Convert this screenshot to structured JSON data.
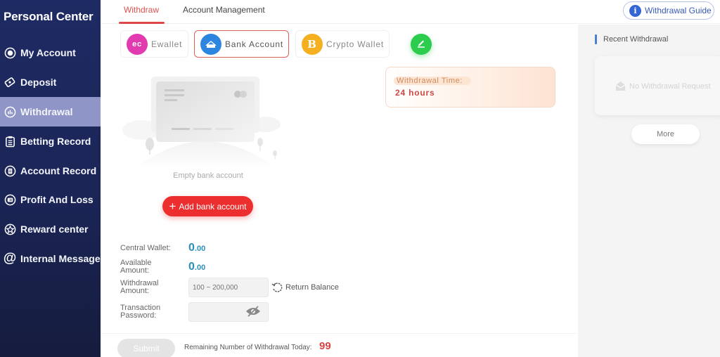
{
  "sidebar": {
    "title": "Personal Center",
    "items": [
      {
        "label": "My Account",
        "icon": "account-icon",
        "active": false
      },
      {
        "label": "Deposit",
        "icon": "deposit-icon",
        "active": false
      },
      {
        "label": "Withdrawal",
        "icon": "withdrawal-icon",
        "active": true
      },
      {
        "label": "Betting Record",
        "icon": "clipboard-icon",
        "active": false
      },
      {
        "label": "Account Record",
        "icon": "record-icon",
        "active": false
      },
      {
        "label": "Profit And Loss",
        "icon": "profit-icon",
        "active": false
      },
      {
        "label": "Reward center",
        "icon": "reward-icon",
        "active": false
      },
      {
        "label": "Internal Message",
        "icon": "at-icon",
        "active": false
      }
    ]
  },
  "tabs": [
    {
      "label": "Withdraw",
      "active": true
    },
    {
      "label": "Account Management",
      "active": false
    }
  ],
  "guide_button": {
    "label": "Withdrawal Guide",
    "icon": "info-icon"
  },
  "methods": [
    {
      "label": "Ewallet",
      "icon": "ewallet-icon",
      "icon_text": "ec",
      "color": "#e23bb0",
      "active": false
    },
    {
      "label": "Bank Account",
      "icon": "bank-card-icon",
      "color": "#2c86e0",
      "active": true
    },
    {
      "label": "Crypto Wallet",
      "icon": "bitcoin-icon",
      "icon_text": "B",
      "color": "#f4b01f",
      "active": false
    }
  ],
  "edit_button": {
    "icon": "pencil-icon",
    "color": "#2ccc4f"
  },
  "withdrawal_time": {
    "label": "Withdrawal Time:",
    "value": "24 hours"
  },
  "empty_state": {
    "text": "Empty bank account",
    "button_label": "Add bank account"
  },
  "form": {
    "central_wallet": {
      "label": "Central Wallet:",
      "value_int": "0",
      "value_dec": ".00"
    },
    "available_amount": {
      "label_line1": "Available",
      "label_line2": "Amount:",
      "value_int": "0",
      "value_dec": ".00"
    },
    "withdrawal_amount": {
      "label_line1": "Withdrawal",
      "label_line2": "Amount:",
      "placeholder": "100 ~ 200,000",
      "value": ""
    },
    "return_balance": "Return Balance",
    "transaction_password": {
      "label_line1": "Transaction",
      "label_line2": "Password:",
      "value": ""
    }
  },
  "footer": {
    "submit_label": "Submit",
    "remaining_label": "Remaining Number of Withdrawal Today:",
    "remaining_count": "99"
  },
  "recent": {
    "title": "Recent Withdrawal",
    "empty_text": "No Withdrawal Request",
    "more_label": "More"
  },
  "colors": {
    "sidebar_bg": "#1e2a63",
    "sidebar_active": "#8f95c6",
    "accent_red": "#e04848",
    "value_blue": "#2a8fb8"
  }
}
